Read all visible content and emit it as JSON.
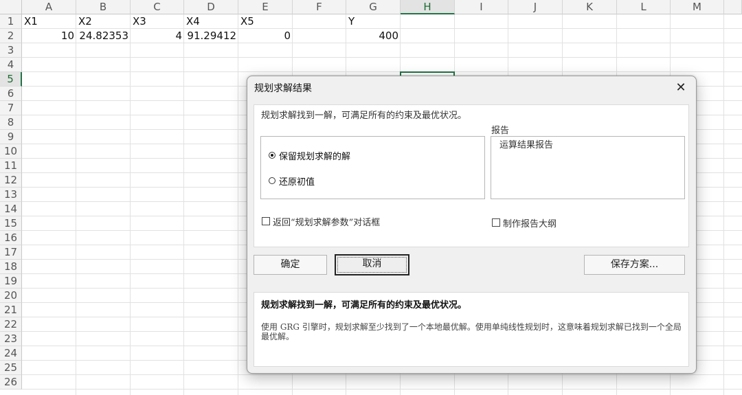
{
  "spreadsheet": {
    "columns": [
      "A",
      "B",
      "C",
      "D",
      "E",
      "F",
      "G",
      "H",
      "I",
      "J",
      "K",
      "L",
      "M"
    ],
    "active_column": "H",
    "rows": [
      "1",
      "2",
      "3",
      "4",
      "5",
      "6",
      "7",
      "8",
      "9",
      "10",
      "11",
      "12",
      "13",
      "14",
      "15",
      "16",
      "17",
      "18",
      "19",
      "20",
      "21",
      "22",
      "23",
      "24",
      "25",
      "26"
    ],
    "active_row": "5",
    "headers_row": [
      "X1",
      "X2",
      "X3",
      "X4",
      "X5",
      "",
      "Y"
    ],
    "values_row": [
      "10",
      "24.82353",
      "4",
      "91.29412",
      "0",
      "",
      "400"
    ]
  },
  "dialog": {
    "title": "规划求解结果",
    "close_glyph": "✕",
    "result_message": "规划求解找到一解，可满足所有的约束及最优状况。",
    "options": [
      {
        "label": "保留规划求解的解",
        "selected": true
      },
      {
        "label": "还原初值",
        "selected": false
      }
    ],
    "report_label": "报告",
    "reports": [
      "运算结果报告"
    ],
    "return_checkbox_label": "返回“规划求解参数”对话框",
    "outline_checkbox_label": "制作报告大纲",
    "buttons": {
      "ok": "确定",
      "cancel": "取消",
      "save_scenario": "保存方案..."
    },
    "details_heading": "规划求解找到一解，可满足所有的约束及最优状况。",
    "details_text": "使用 GRG 引擎时，规划求解至少找到了一个本地最优解。使用单纯线性规划时，这意味着规划求解已找到一个全局最优解。"
  }
}
